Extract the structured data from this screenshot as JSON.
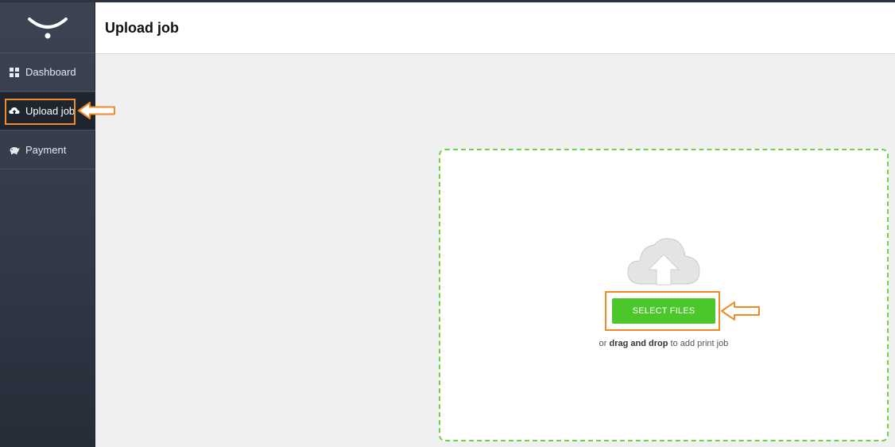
{
  "sidebar": {
    "logo_icon": "smile-logo",
    "items": [
      {
        "label": "Dashboard",
        "icon": "grid-icon",
        "active": false
      },
      {
        "label": "Upload job",
        "icon": "cloud-upload-icon",
        "active": true
      },
      {
        "label": "Payment",
        "icon": "piggy-bank-icon",
        "active": false
      }
    ]
  },
  "header": {
    "title": "Upload job"
  },
  "upload": {
    "button_label": "SELECT FILES",
    "hint_prefix": "or",
    "hint_bold": "drag and drop",
    "hint_suffix": "to add print job",
    "cloud_icon": "cloud-upload-icon"
  },
  "colors": {
    "sidebar_bg": "#353d4b",
    "accent_green": "#4cc72a",
    "dropzone_border": "#6fd144",
    "highlight_orange": "#f28a2b"
  }
}
